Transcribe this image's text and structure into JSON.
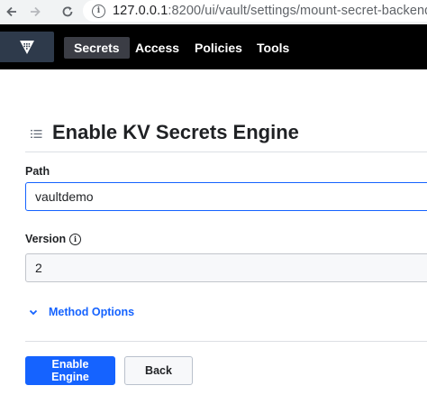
{
  "browser": {
    "url_host": "127.0.0.1",
    "url_path": ":8200/ui/vault/settings/mount-secret-backend"
  },
  "navbar": {
    "items": [
      {
        "label": "Secrets"
      },
      {
        "label": "Access"
      },
      {
        "label": "Policies"
      },
      {
        "label": "Tools"
      }
    ]
  },
  "page": {
    "title": "Enable KV Secrets Engine"
  },
  "form": {
    "path": {
      "label": "Path",
      "value": "vaultdemo"
    },
    "version": {
      "label": "Version",
      "value": "2"
    },
    "method_options_label": "Method Options"
  },
  "actions": {
    "enable_label": "Enable Engine",
    "back_label": "Back"
  },
  "colors": {
    "accent": "#1563ff",
    "navbar_bg": "#000000",
    "active_nav": "#3b3d45"
  }
}
